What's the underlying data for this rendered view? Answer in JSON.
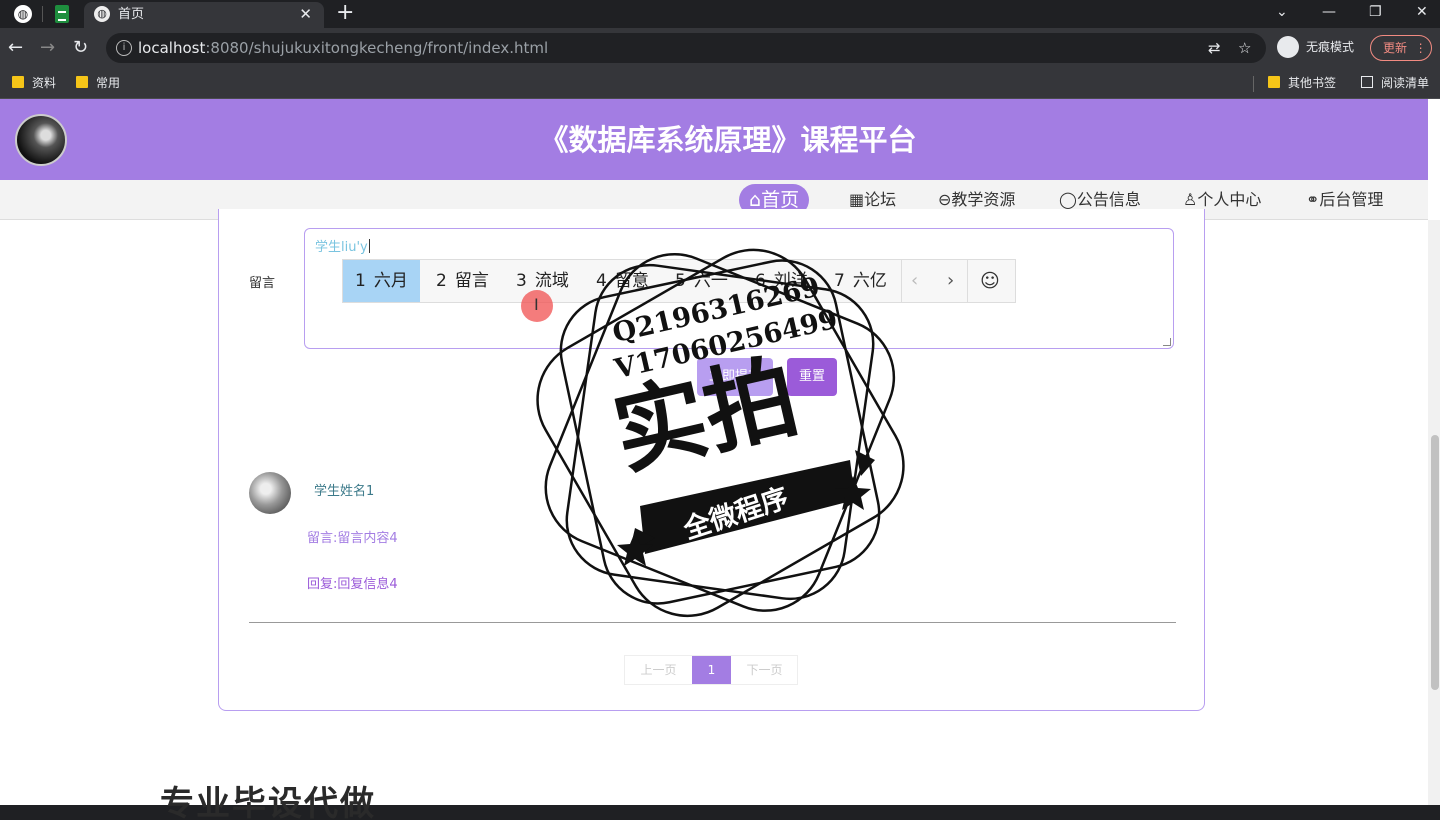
{
  "browser": {
    "tab_title": "首页",
    "tab_close": "✕",
    "new_tab": "+",
    "url_host": "localhost",
    "url_rest": ":8080/shujukuxitongkecheng/front/index.html",
    "incognito_label": "无痕模式",
    "update_label": "更新",
    "bookmarks": [
      "资料",
      "常用"
    ],
    "bookmarks_right": [
      "其他书签",
      "阅读清单"
    ]
  },
  "site": {
    "title": "《数据库系统原理》课程平台",
    "nav": [
      {
        "icon": "⌂",
        "label": "首页"
      },
      {
        "icon": "▦",
        "label": "论坛"
      },
      {
        "icon": "⊖",
        "label": "教学资源"
      },
      {
        "icon": "◯",
        "label": "公告信息"
      },
      {
        "icon": "♙",
        "label": "个人中心"
      },
      {
        "icon": "⚭",
        "label": "后台管理"
      }
    ]
  },
  "form": {
    "message_label": "留言",
    "message_value": "学生liu'y",
    "submit_label": "立即提交",
    "reset_label": "重置"
  },
  "ime": {
    "candidates": [
      {
        "num": "1",
        "text": "六月"
      },
      {
        "num": "2",
        "text": "留言"
      },
      {
        "num": "3",
        "text": "流域"
      },
      {
        "num": "4",
        "text": "留意"
      },
      {
        "num": "5",
        "text": "六一"
      },
      {
        "num": "6",
        "text": "刘洋"
      },
      {
        "num": "7",
        "text": "六亿"
      }
    ],
    "prev": "‹",
    "next": "›",
    "emoji": "☺"
  },
  "comment": {
    "student_name": "学生姓名1",
    "message": "留言:留言内容4",
    "reply": "回复:回复信息4"
  },
  "pagination": {
    "prev_label": "上一页",
    "current": "1",
    "next_label": "下一页"
  },
  "overlay": {
    "stamp_line1": "Q2196316269",
    "stamp_line2": "V17060256499",
    "stamp_main": "实拍",
    "stamp_ribbon": "全微程序",
    "caption": "专业毕设代做"
  }
}
